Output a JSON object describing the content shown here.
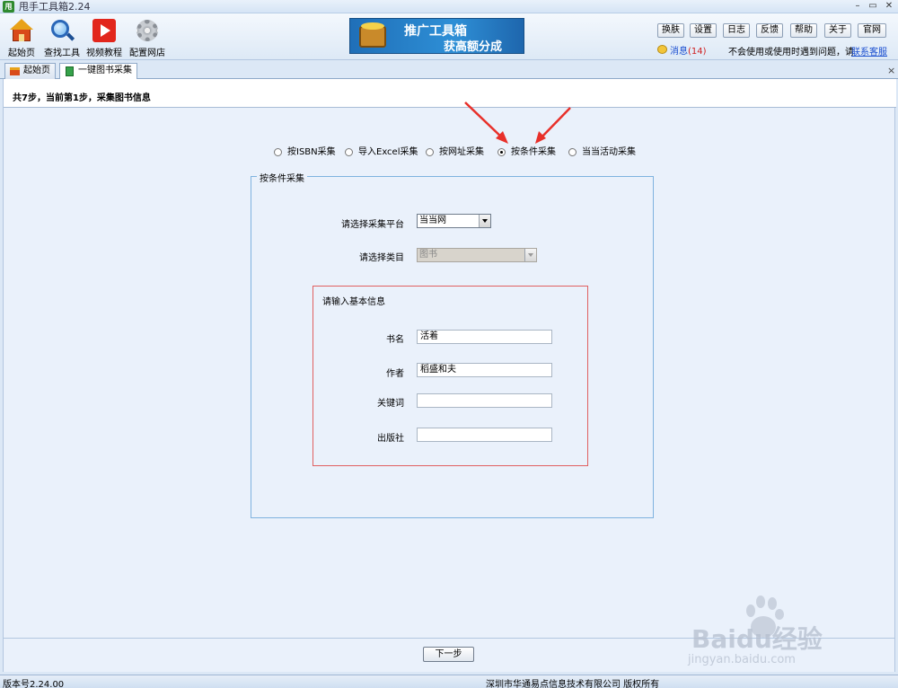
{
  "window": {
    "icon_text": "甩",
    "title": "甩手工具箱2.24",
    "controls": [
      "–",
      "▭",
      "✕"
    ]
  },
  "toolbar": {
    "tools": [
      {
        "label": "起始页",
        "icon": "home-icon"
      },
      {
        "label": "查找工具",
        "icon": "magnifier-icon"
      },
      {
        "label": "视频教程",
        "icon": "play-icon"
      },
      {
        "label": "配置网店",
        "icon": "gear-icon"
      }
    ],
    "banner": {
      "line1": "推广工具箱",
      "line2": "获高额分成"
    },
    "buttons": [
      "换肤",
      "设置",
      "日志",
      "反馈",
      "帮助",
      "关于",
      "官网"
    ],
    "message_label": "消息",
    "message_count": "(14)",
    "help_text": "不会使用或使用时遇到问题，请",
    "service_link": "联系客服"
  },
  "tabs": [
    {
      "label": "起始页",
      "icon": "home-icon",
      "active": false
    },
    {
      "label": "一键图书采集",
      "icon": "book-icon",
      "active": true
    }
  ],
  "tab_close": "×",
  "step_text": "共7步，当前第1步，采集图书信息",
  "modes": [
    {
      "label": "按ISBN采集",
      "selected": false
    },
    {
      "label": "导入Excel采集",
      "selected": false
    },
    {
      "label": "按网址采集",
      "selected": false
    },
    {
      "label": "按条件采集",
      "selected": true
    },
    {
      "label": "当当活动采集",
      "selected": false
    }
  ],
  "form": {
    "legend": "按条件采集",
    "platform_label": "请选择采集平台",
    "platform_value": "当当网",
    "category_label": "请选择类目",
    "category_value": "图书",
    "basic_info_title": "请输入基本信息",
    "fields": {
      "title_label": "书名",
      "title_value": "活着",
      "author_label": "作者",
      "author_value": "稻盛和夫",
      "keyword_label": "关键词",
      "keyword_value": "",
      "publisher_label": "出版社",
      "publisher_value": ""
    }
  },
  "next_button": "下一步",
  "status": {
    "version": "版本号2.24.00",
    "copyright": "深圳市华通易点信息技术有限公司  版权所有"
  },
  "watermark": {
    "brand": "Baidu经验",
    "url": "jingyan.baidu.com"
  },
  "colors": {
    "arrow": "#e8302a",
    "fieldset_border": "#7fb3df",
    "info_box_border": "#e06060",
    "link": "#1b4fd0"
  }
}
